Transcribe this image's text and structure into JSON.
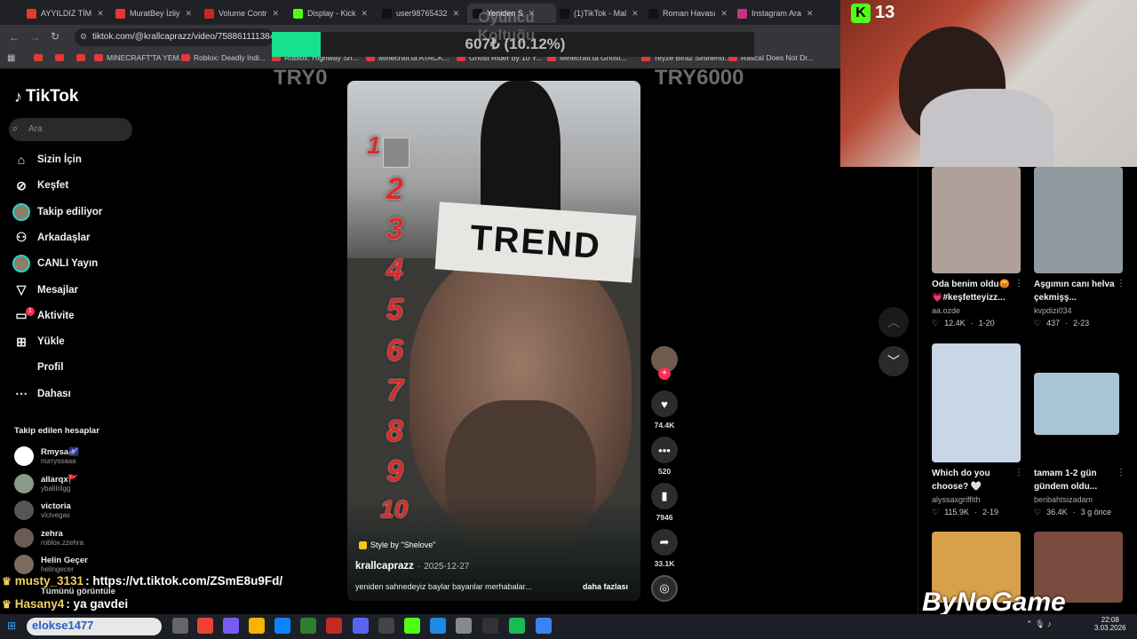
{
  "browser": {
    "tabs": [
      {
        "label": "AYYILDIZ TİM",
        "color": "#e53935"
      },
      {
        "label": "MuratBey İzliy",
        "color": "#e53935"
      },
      {
        "label": "Volume Contr",
        "color": "#c62828"
      },
      {
        "label": "Display - Kick",
        "color": "#53fc18"
      },
      {
        "label": "user98765432",
        "color": "#111111"
      },
      {
        "label": "Yeniden S",
        "color": "#111111"
      },
      {
        "label": "(1)TikTok - Mal",
        "color": "#111111"
      },
      {
        "label": "Roman Havası",
        "color": "#111111"
      },
      {
        "label": "Instagram Ara",
        "color": "#c13584"
      }
    ],
    "url": "tiktok.com/@krallcaprazz/video/7588611113848",
    "bookmarks": [
      "MINECRAFT'TA YEM...",
      "Roblox: Deadly Indi...",
      "Roblox: Highway Sn...",
      "Minecraft'ta ATACK...",
      "Ghost Rider by 10 Y...",
      "Minecraft'ta Ghost...",
      "Teyze Biraz Sinirlend...",
      "Rascal Does Not Dr..."
    ]
  },
  "overlay": {
    "title": "Oyuncu Koltuğu",
    "progress_text": "607₺ (10.12%)",
    "progress_fraction": 0.1012,
    "goal_start": "TRY0",
    "goal_end": "TRY6000",
    "accent": "#17e08f"
  },
  "kick": {
    "viewers": "13",
    "color": "#53fc18"
  },
  "sidebar": {
    "logo": "TikTok",
    "search_placeholder": "Ara",
    "items": [
      {
        "label": "Sizin İçin",
        "icon": "home-icon"
      },
      {
        "label": "Keşfet",
        "icon": "compass-icon"
      },
      {
        "label": "Takip ediliyor",
        "icon": "avatar"
      },
      {
        "label": "Arkadaşlar",
        "icon": "friends-icon"
      },
      {
        "label": "CANLI Yayın",
        "icon": "avatar"
      },
      {
        "label": "Mesajlar",
        "icon": "message-icon"
      },
      {
        "label": "Aktivite",
        "icon": "activity-icon",
        "badge": "1"
      },
      {
        "label": "Yükle",
        "icon": "upload-icon"
      },
      {
        "label": "Profil",
        "icon": "none"
      },
      {
        "label": "Dahası",
        "icon": "more-icon"
      }
    ],
    "following_header": "Takip edilen hesaplar",
    "following": [
      {
        "name": "Rmysa🌌",
        "user": "nurryssaaa"
      },
      {
        "name": "allarqx🚩",
        "user": "ybalilrilgg"
      },
      {
        "name": "victoria",
        "user": "vicivegas"
      },
      {
        "name": "zehra",
        "user": "roblox.zzehra"
      },
      {
        "name": "Helin Geçer",
        "user": "helingecer"
      }
    ],
    "see_all": "Tümünü görüntüle"
  },
  "chat": [
    {
      "user": "musty_3131",
      "text": ": https://vt.tiktok.com/ZSmE8u9Fd/"
    },
    {
      "user": "Hasany4",
      "text": ": ya gavdei"
    }
  ],
  "video": {
    "trend_label": "TREND",
    "numbers": [
      "1",
      "2",
      "3",
      "4",
      "5",
      "6",
      "7",
      "8",
      "9",
      "10"
    ],
    "style_tag": "Style by \"Shelove\"",
    "author": "krallcaprazz",
    "date": "2025-12-27",
    "description": "yeniden sahnedeyiz baylar bayanlar merhabalar...",
    "more": "daha fazlası",
    "likes": "74.4K",
    "comments": "520",
    "saves": "7946",
    "shares": "33.1K"
  },
  "feed": [
    {
      "caption1": "Oda benim oldu😡",
      "caption2": "💗#keşfetteyizz...",
      "user": "aa.ozde",
      "likes": "12.4K",
      "meta": "1-20",
      "color": "#b0a09a"
    },
    {
      "caption1": "Aşgımın canı helva",
      "caption2": "çekmişş...",
      "user": "kvpdizi034",
      "likes": "437",
      "meta": "2-23",
      "color": "#8e9aa0"
    },
    {
      "caption1": "Which do you",
      "caption2": "choose? 🤍",
      "user": "alyssaxgriffith",
      "likes": "115.9K",
      "meta": "2-19",
      "color": "#c8d6e6"
    },
    {
      "caption1": "tamam 1-2 gün",
      "caption2": "gündem oldu...",
      "user": "benbahtsizadam",
      "likes": "36.4K",
      "meta": "3 g önce",
      "color": "#a9c4d4"
    },
    {
      "caption1": "",
      "caption2": "",
      "user": "",
      "likes": "",
      "meta": "",
      "color": "#d8a04a"
    },
    {
      "caption1": "",
      "caption2": "",
      "user": "",
      "likes": "",
      "meta": "",
      "color": "#7a4b3f"
    }
  ],
  "watermark": "ByNoGame",
  "taskbar": {
    "user_label": "elokse1477",
    "time": "22:08",
    "date": "3.03.2026"
  }
}
